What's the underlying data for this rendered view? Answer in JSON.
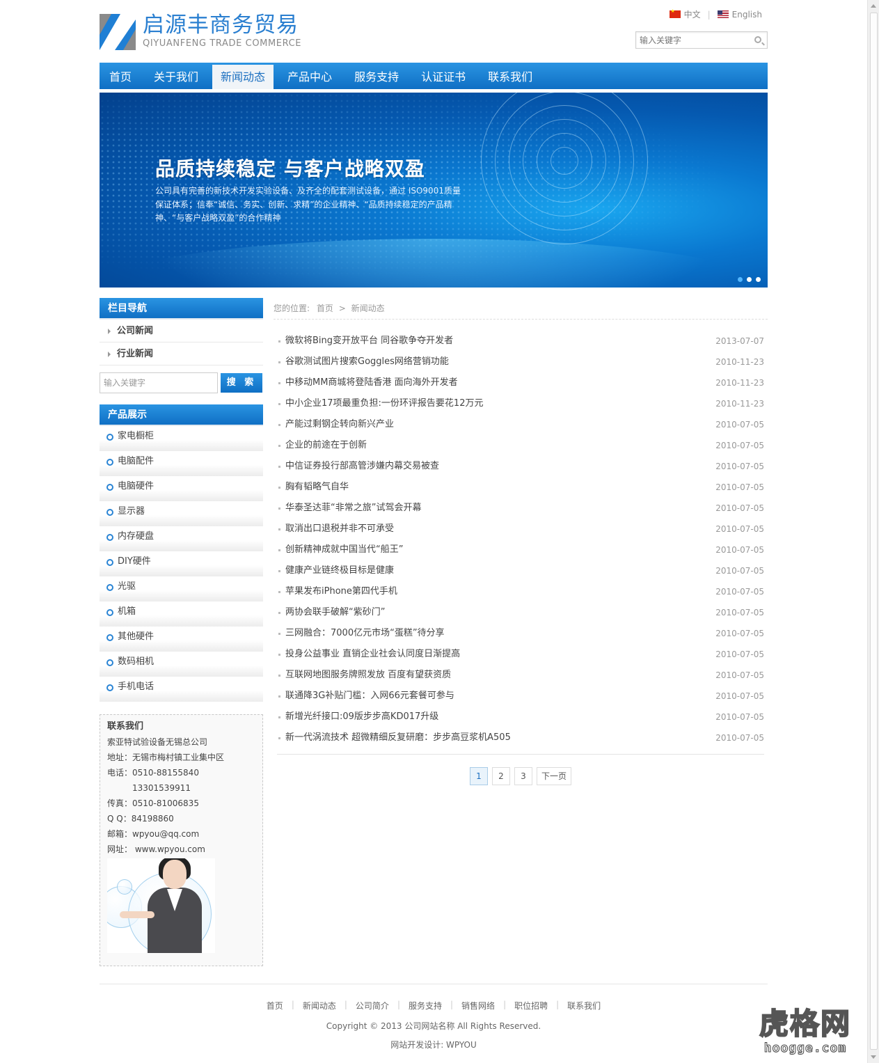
{
  "header": {
    "logo_cn": "启源丰商务贸易",
    "logo_en": "QIYUANFENG TRADE COMMERCE",
    "lang_cn": "中文",
    "lang_en": "English",
    "search_placeholder": "输入关键字"
  },
  "nav": {
    "items": [
      "首页",
      "关于我们",
      "新闻动态",
      "产品中心",
      "服务支持",
      "认证证书",
      "联系我们"
    ],
    "active_index": 2
  },
  "banner": {
    "title": "品质持续稳定  与客户战略双盈",
    "text": "公司具有完善的新技术开发实验设备、及齐全的配套测试设备，通过 ISO9001质量保证体系；信奉“诚信、务实、创新、求精”的企业精神、“品质持续稳定的产品精神、“与客户战略双盈”的合作精神",
    "slides": 3,
    "active_slide": 1
  },
  "sidebar": {
    "column_title": "栏目导航",
    "columns": [
      "公司新闻",
      "行业新闻"
    ],
    "search_placeholder": "输入关键字",
    "search_button": "搜 索",
    "products_title": "产品展示",
    "products": [
      "家电橱柜",
      "电脑配件",
      "电脑硬件",
      "显示器",
      "内存硬盘",
      "DIY硬件",
      "光驱",
      "机箱",
      "其他硬件",
      "数码相机",
      "手机电话"
    ],
    "contact": {
      "title": "联系我们",
      "company": "索亚特试验设备无锡总公司",
      "address": "地址：无锡市梅村镇工业集中区",
      "phone": "电话：0510-88155840",
      "phone2": "13301539911",
      "fax": "传真：0510-81006835",
      "qq": "Q Q：84198860",
      "email": "邮箱：wpyou@qq.com",
      "website": "网址： www.wpyou.com"
    }
  },
  "main": {
    "crumb_label": "您的位置:",
    "crumb_home": "首页",
    "crumb_sep": ">",
    "crumb_current": "新闻动态",
    "news": [
      {
        "title": "微软将Bing变开放平台 同谷歌争夺开发者",
        "date": "2013-07-07"
      },
      {
        "title": "谷歌测试图片搜索Goggles网络营销功能",
        "date": "2010-11-23"
      },
      {
        "title": "中移动MM商城将登陆香港 面向海外开发者",
        "date": "2010-11-23"
      },
      {
        "title": "中小企业17项最重负担:一份环评报告要花12万元",
        "date": "2010-11-23"
      },
      {
        "title": "产能过剩钢企转向新兴产业",
        "date": "2010-07-05"
      },
      {
        "title": "企业的前途在于创新",
        "date": "2010-07-05"
      },
      {
        "title": "中信证券投行部高管涉嫌内幕交易被查",
        "date": "2010-07-05"
      },
      {
        "title": "胸有韬略气自华",
        "date": "2010-07-05"
      },
      {
        "title": "华泰圣达菲“非常之旅”试驾会开幕",
        "date": "2010-07-05"
      },
      {
        "title": "取消出口退税并非不可承受",
        "date": "2010-07-05"
      },
      {
        "title": "创新精神成就中国当代“船王”",
        "date": "2010-07-05"
      },
      {
        "title": "健康产业链终极目标是健康",
        "date": "2010-07-05"
      },
      {
        "title": "苹果发布iPhone第四代手机",
        "date": "2010-07-05"
      },
      {
        "title": "两协会联手破解“紫砂门”",
        "date": "2010-07-05"
      },
      {
        "title": "三网融合：7000亿元市场“蛋糕”待分享",
        "date": "2010-07-05"
      },
      {
        "title": "投身公益事业 直销企业社会认同度日渐提高",
        "date": "2010-07-05"
      },
      {
        "title": "互联网地图服务牌照发放 百度有望获资质",
        "date": "2010-07-05"
      },
      {
        "title": "联通降3G补贴门槛：入网66元套餐可参与",
        "date": "2010-07-05"
      },
      {
        "title": "新增光纤接口:09版步步高KD017升级",
        "date": "2010-07-05"
      },
      {
        "title": "新一代涡流技术 超微精细反复研磨：步步高豆浆机A505",
        "date": "2010-07-05"
      }
    ],
    "pager": [
      "1",
      "2",
      "3",
      "下一页"
    ],
    "pager_current": 0
  },
  "footer": {
    "links": [
      "首页",
      "新闻动态",
      "公司简介",
      "服务支持",
      "销售网络",
      "职位招聘",
      "联系我们"
    ],
    "copyright": "Copyright © 2013 公司网站名称 All Rights Reserved.",
    "design": "网站开发设计: WPYOU"
  },
  "watermark": {
    "cn": "虎格网",
    "en": "hoogge.com"
  },
  "colors": {
    "accent": "#1b7fd4",
    "nav_dark": "#0f6fc4",
    "logo_text": "#2a7fd0"
  }
}
